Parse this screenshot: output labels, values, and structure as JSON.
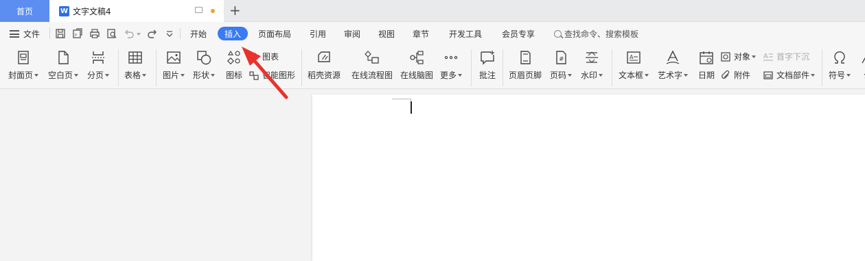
{
  "tabs": {
    "home": "首页",
    "doc_title": "文字文稿4",
    "doc_icon_letter": "W",
    "plus": "+"
  },
  "menubar": {
    "file": "文件",
    "items": [
      "开始",
      "插入",
      "页面布局",
      "引用",
      "审阅",
      "视图",
      "章节",
      "开发工具",
      "会员专享"
    ],
    "active": "插入",
    "search_placeholder": "查找命令、搜索模板"
  },
  "ribbon": {
    "cover": "封面页",
    "blank": "空白页",
    "page_break": "分页",
    "table": "表格",
    "picture": "图片",
    "shape": "形状",
    "icon": "图标",
    "chart": "图表",
    "smart_graphic": "智能图形",
    "daoke": "稻壳资源",
    "flowchart": "在线流程图",
    "mindmap": "在线脑图",
    "more": "更多",
    "comment": "批注",
    "header_footer": "页眉页脚",
    "page_number": "页码",
    "watermark": "水印",
    "textbox": "文本框",
    "wordart": "艺术字",
    "date": "日期",
    "object": "对象",
    "attachment": "附件",
    "drop_cap": "首字下沉",
    "doc_parts": "文档部件",
    "symbol": "符号",
    "formula": "公"
  },
  "colors": {
    "accent": "#3a7af2",
    "home_tab": "#5b8ef0",
    "arrow": "#e8322c"
  }
}
